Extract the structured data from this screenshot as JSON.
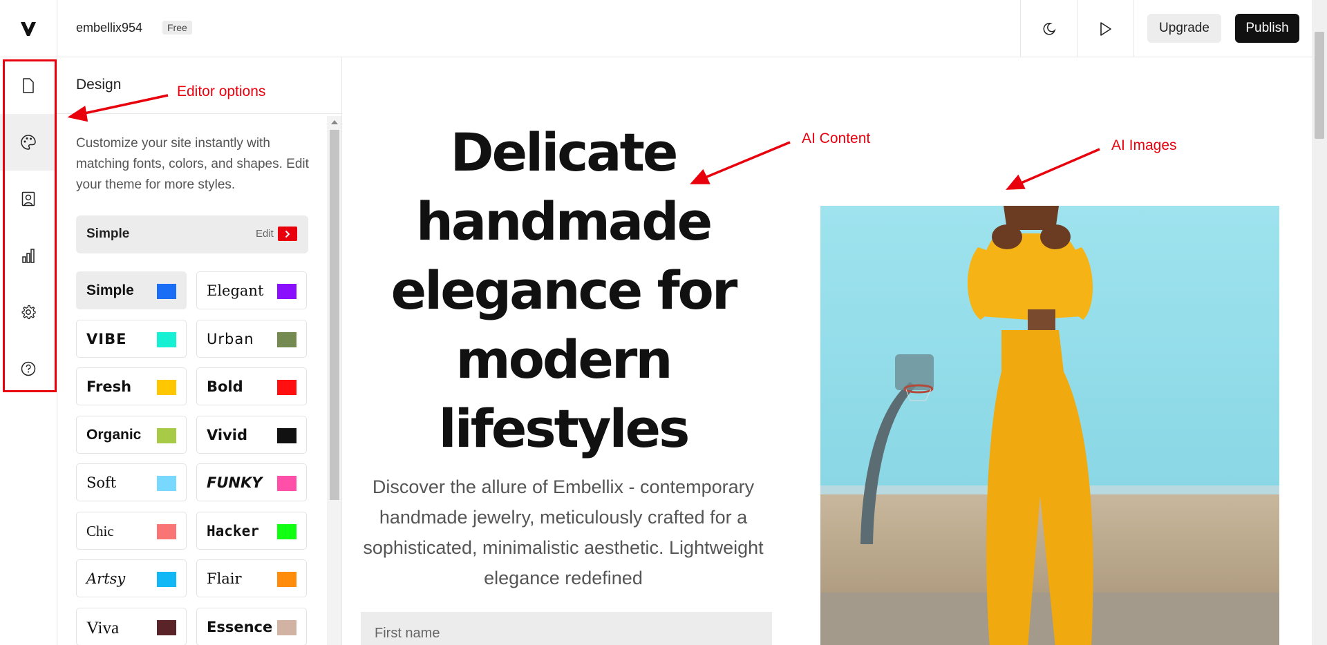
{
  "app": {
    "site_name": "embellix954",
    "plan_badge": "Free"
  },
  "toolbar": {
    "dark_mode_icon": "moon-icon",
    "preview_icon": "play-icon",
    "upgrade_label": "Upgrade",
    "publish_label": "Publish"
  },
  "rail": {
    "items": [
      {
        "icon": "page-icon",
        "active": false
      },
      {
        "icon": "palette-icon",
        "active": true
      },
      {
        "icon": "portrait-icon",
        "active": false
      },
      {
        "icon": "bar-chart-icon",
        "active": false
      },
      {
        "icon": "gear-icon",
        "active": false
      },
      {
        "icon": "help-icon",
        "active": false
      }
    ]
  },
  "panel": {
    "title": "Design",
    "description": "Customize your site instantly with matching fonts, colors, and shapes. Edit your theme for more styles.",
    "current_theme": {
      "name": "Simple",
      "edit_label": "Edit"
    },
    "themes": [
      {
        "name": "Simple",
        "color": "#1a6ef5",
        "selected": true
      },
      {
        "name": "Elegant",
        "color": "#8b0fff",
        "selected": false
      },
      {
        "name": "VIBE",
        "color": "#17f0d3",
        "selected": false
      },
      {
        "name": "Urban",
        "color": "#748a50",
        "selected": false
      },
      {
        "name": "Fresh",
        "color": "#ffc700",
        "selected": false
      },
      {
        "name": "Bold",
        "color": "#ff0f0f",
        "selected": false
      },
      {
        "name": "Organic",
        "color": "#a8cb47",
        "selected": false
      },
      {
        "name": "Vivid",
        "color": "#111111",
        "selected": false
      },
      {
        "name": "Soft",
        "color": "#78d8ff",
        "selected": false
      },
      {
        "name": "FUNKY",
        "color": "#ff4fa8",
        "selected": false
      },
      {
        "name": "Chic",
        "color": "#f97575",
        "selected": false
      },
      {
        "name": "Hacker",
        "color": "#11ff11",
        "selected": false
      },
      {
        "name": "Artsy",
        "color": "#12b8f5",
        "selected": false
      },
      {
        "name": "Flair",
        "color": "#ff8c0a",
        "selected": false
      },
      {
        "name": "Viva",
        "color": "#5a2328",
        "selected": false
      },
      {
        "name": "Essence",
        "color": "#d2b3a3",
        "selected": false
      }
    ]
  },
  "canvas": {
    "hero_title": "Delicate handmade elegance for modern lifestyles",
    "hero_subtitle": "Discover the allure of Embellix - contemporary handmade jewelry, meticulously crafted for a sophisticated, minimalistic aesthetic. Lightweight elegance redefined",
    "first_name_placeholder": "First name",
    "hero_image": "woman-in-yellow-tracksuit-photo"
  },
  "annotations": {
    "editor_options": "Editor options",
    "ai_content": "AI Content",
    "ai_images": "AI Images"
  },
  "colors": {
    "accent_red": "#e8000d",
    "publish_bg": "#111111"
  }
}
